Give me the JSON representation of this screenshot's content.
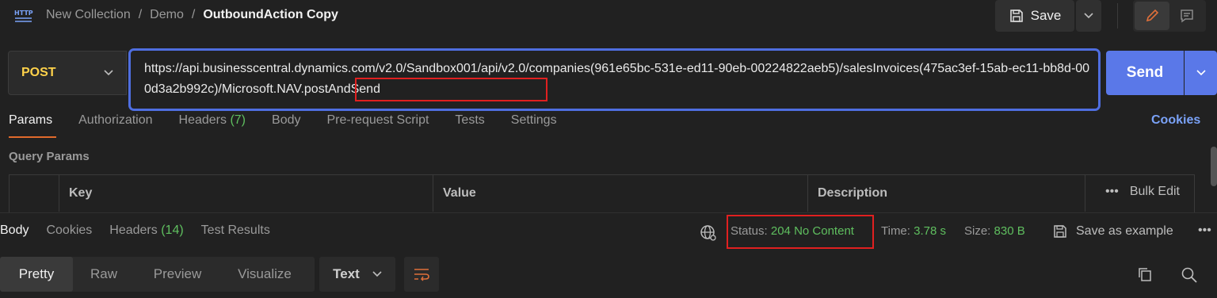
{
  "header": {
    "icon_text": "HTTP",
    "breadcrumb": [
      "New Collection",
      "Demo",
      "OutboundAction Copy"
    ],
    "separator": "/",
    "save_label": "Save"
  },
  "request": {
    "method": "POST",
    "url": "https://api.businesscentral.dynamics.com/v2.0/Sandbox001/api/v2.0/companies(961e65bc-531e-ed11-90eb-00224822aeb5)/salesInvoices(475ac3ef-15ab-ec11-bb8d-000d3a2b992c)/Microsoft.NAV.postAndSend",
    "send_label": "Send",
    "tabs": [
      {
        "label": "Params",
        "count": ""
      },
      {
        "label": "Authorization",
        "count": ""
      },
      {
        "label": "Headers",
        "count": "(7)"
      },
      {
        "label": "Body",
        "count": ""
      },
      {
        "label": "Pre-request Script",
        "count": ""
      },
      {
        "label": "Tests",
        "count": ""
      },
      {
        "label": "Settings",
        "count": ""
      }
    ],
    "cookies_link": "Cookies",
    "query_params_title": "Query Params",
    "table_headers": {
      "key": "Key",
      "value": "Value",
      "description": "Description",
      "bulk_edit": "Bulk Edit",
      "more": "•••"
    }
  },
  "response": {
    "tabs": [
      {
        "label": "Body",
        "count": ""
      },
      {
        "label": "Cookies",
        "count": ""
      },
      {
        "label": "Headers",
        "count": "(14)"
      },
      {
        "label": "Test Results",
        "count": ""
      }
    ],
    "status_label": "Status:",
    "status_value": "204 No Content",
    "time_label": "Time:",
    "time_value": "3.78 s",
    "size_label": "Size:",
    "size_value": "830 B",
    "save_example": "Save as example",
    "more": "•••",
    "format_tabs": [
      "Pretty",
      "Raw",
      "Preview",
      "Visualize"
    ],
    "text_select": "Text"
  },
  "colors": {
    "accent": "#5a78e8",
    "method": "#ffd24a",
    "success": "#5fbf5f",
    "highlight": "#e02020"
  }
}
